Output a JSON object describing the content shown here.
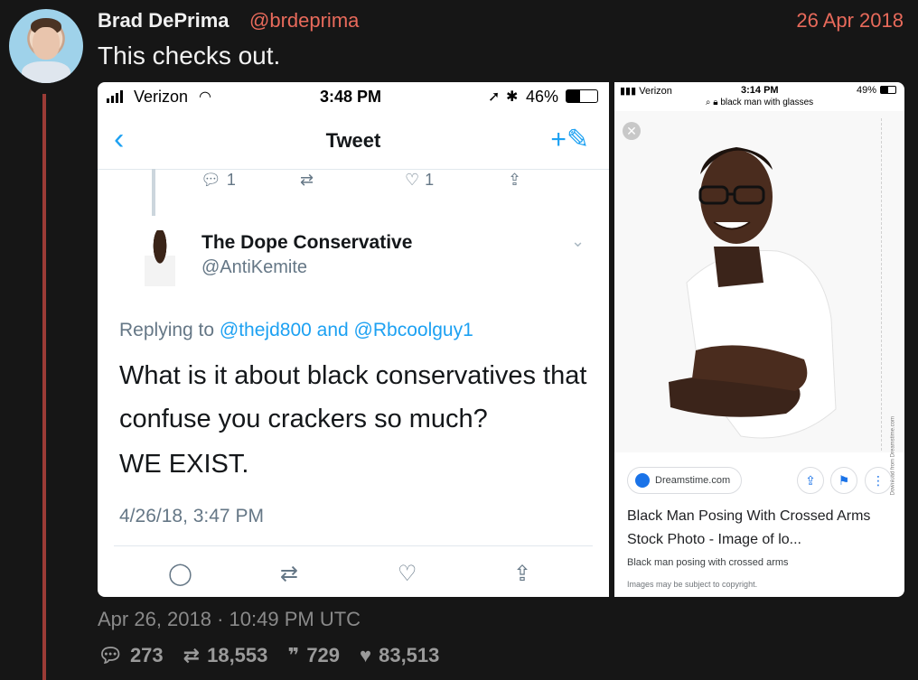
{
  "tweet": {
    "author_name": "Brad DePrima",
    "author_handle": "@brdeprima",
    "date_top": "26 Apr 2018",
    "text": "This checks out.",
    "footer_date": "Apr 26, 2018 · 10:49 PM UTC",
    "stats": {
      "replies": "273",
      "retweets": "18,553",
      "quotes": "729",
      "likes": "83,513"
    }
  },
  "left_screenshot": {
    "carrier": "Verizon",
    "time": "3:48 PM",
    "battery": "46%",
    "nav_title": "Tweet",
    "actions": {
      "reply_count": "1",
      "like_count": "1"
    },
    "author_name": "The Dope Conservative",
    "author_handle": "@AntiKemite",
    "replying_prefix": "Replying to",
    "mention_1": "@thejd800",
    "replying_and": "and",
    "mention_2": "@Rbcoolguy1",
    "body_line": "What is it about black conservatives that confuse you crackers so much?",
    "body_line2": "WE EXIST.",
    "date": "4/26/18, 3:47 PM"
  },
  "right_screenshot": {
    "carrier": "Verizon",
    "time": "3:14 PM",
    "battery": "49%",
    "search_query": "black man with glasses",
    "strip_text": "Download from Dreamstime.com",
    "source": "Dreamstime.com",
    "title": "Black Man Posing With Crossed Arms Stock Photo - Image of lo...",
    "subtitle": "Black man posing with crossed arms",
    "copyright": "Images may be subject to copyright."
  },
  "colors": {
    "background": "#161616",
    "accent": "#e86a5b",
    "thread_line": "#9b3b36",
    "twitter_blue": "#1da1f2"
  },
  "icons": [
    "reply-icon",
    "retweet-icon",
    "quote-icon",
    "heart-icon",
    "share-icon",
    "compose-icon",
    "back-icon"
  ]
}
